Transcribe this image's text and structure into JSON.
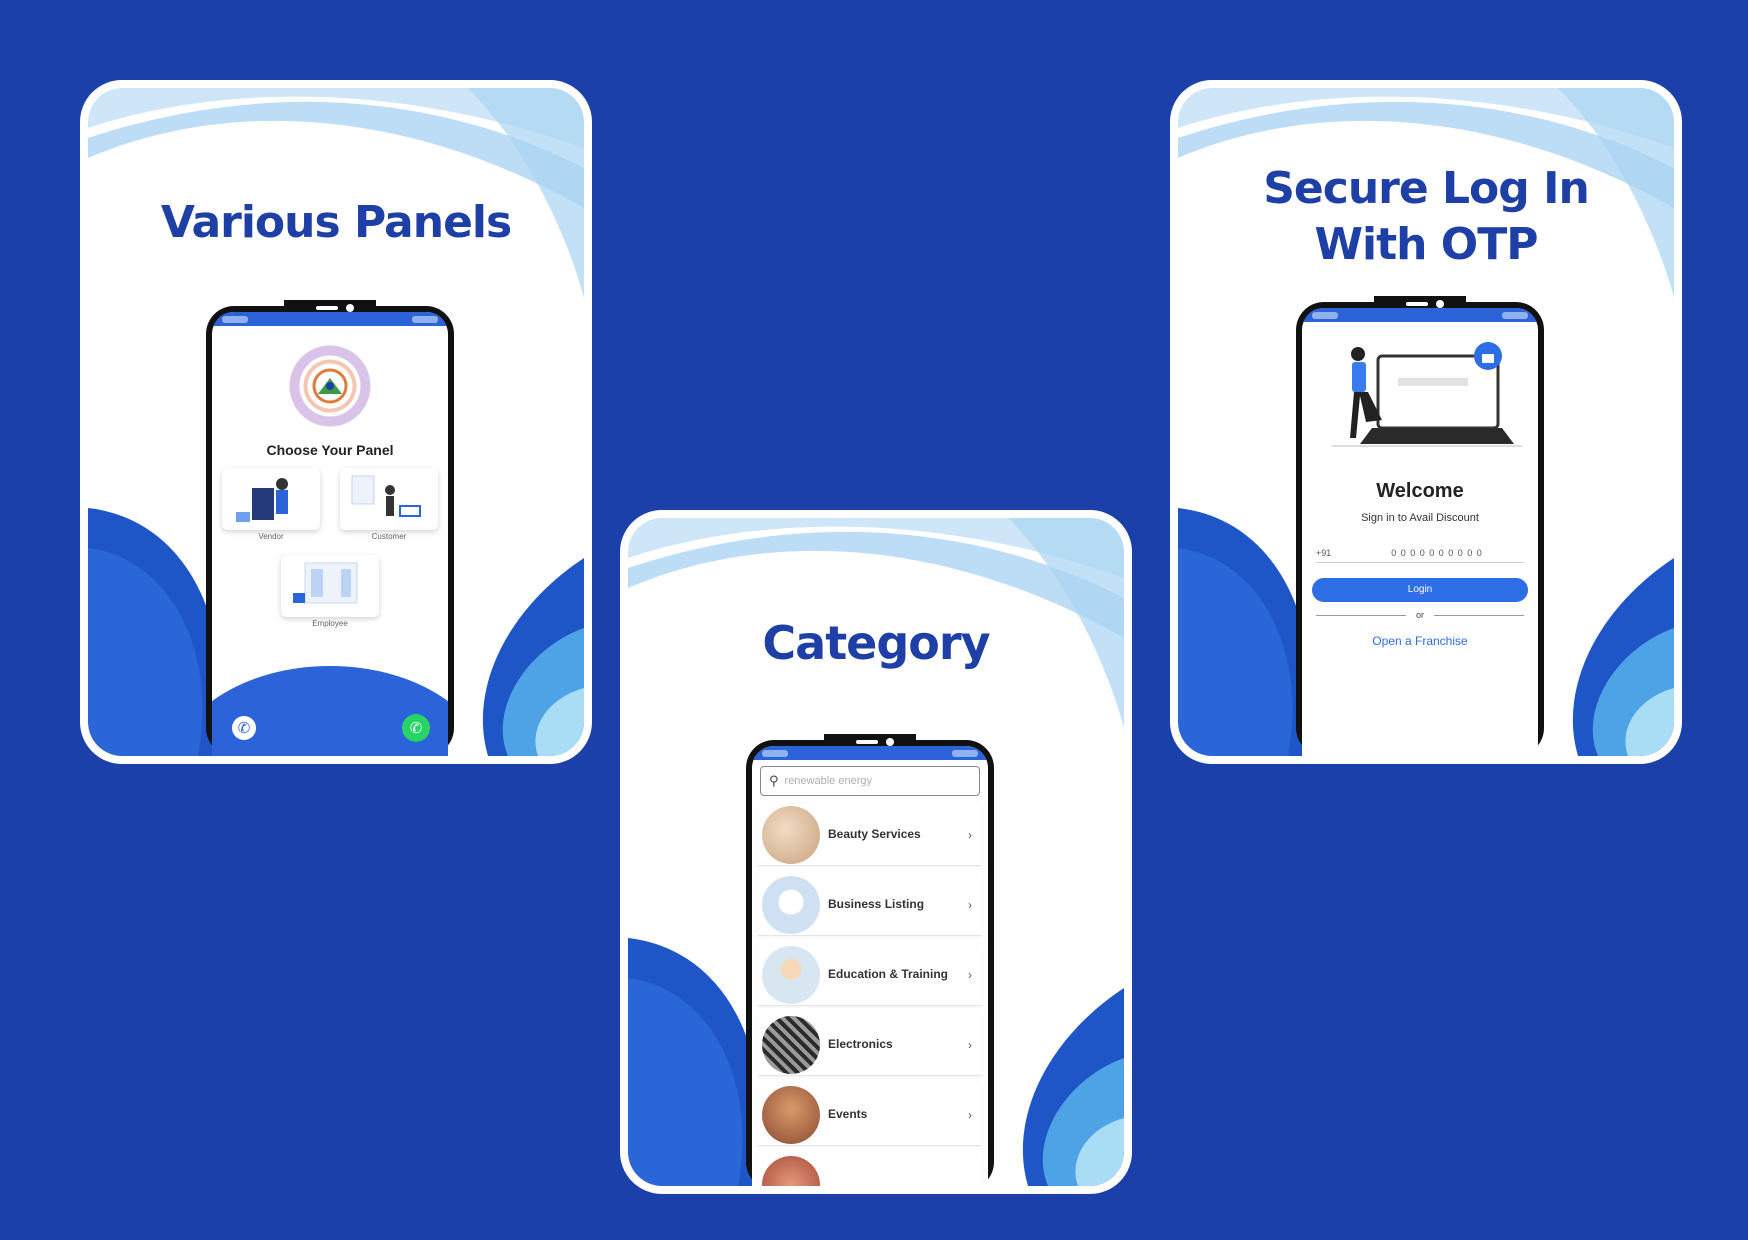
{
  "background_color": "#1c40aa",
  "accent_color": "#2d63d9",
  "title_color": "#1d3fa6",
  "panels_card": {
    "title": "Various Panels",
    "screen": {
      "heading": "Choose Your Panel",
      "options": [
        {
          "label": "Vendor",
          "icon": "vendor-illustration-icon"
        },
        {
          "label": "Customer",
          "icon": "customer-illustration-icon"
        },
        {
          "label": "Employee",
          "icon": "employee-illustration-icon"
        }
      ],
      "call_icon": "phone-icon",
      "whatsapp_icon": "whatsapp-icon"
    }
  },
  "category_card": {
    "title": "Category",
    "screen": {
      "search_placeholder": "renewable energy",
      "items": [
        {
          "label": "Beauty Services",
          "color": "#c9a27e"
        },
        {
          "label": "Business Listing",
          "color": "#cfe0f2"
        },
        {
          "label": "Education & Training",
          "color": "#d7e6f0"
        },
        {
          "label": "Electronics",
          "color": "#4a4a4a"
        },
        {
          "label": "Events",
          "color": "#8a4a32"
        }
      ],
      "chevron": "›"
    }
  },
  "login_card": {
    "title_line1": "Secure Log In",
    "title_line2": "With OTP",
    "screen": {
      "welcome": "Welcome",
      "subtitle": "Sign in to Avail Discount",
      "country_code": "+91",
      "phone_placeholder": "0 0 0 0 0 0 0 0 0 0",
      "login_button": "Login",
      "or_text": "or",
      "franchise_link": "Open a Franchise"
    }
  }
}
